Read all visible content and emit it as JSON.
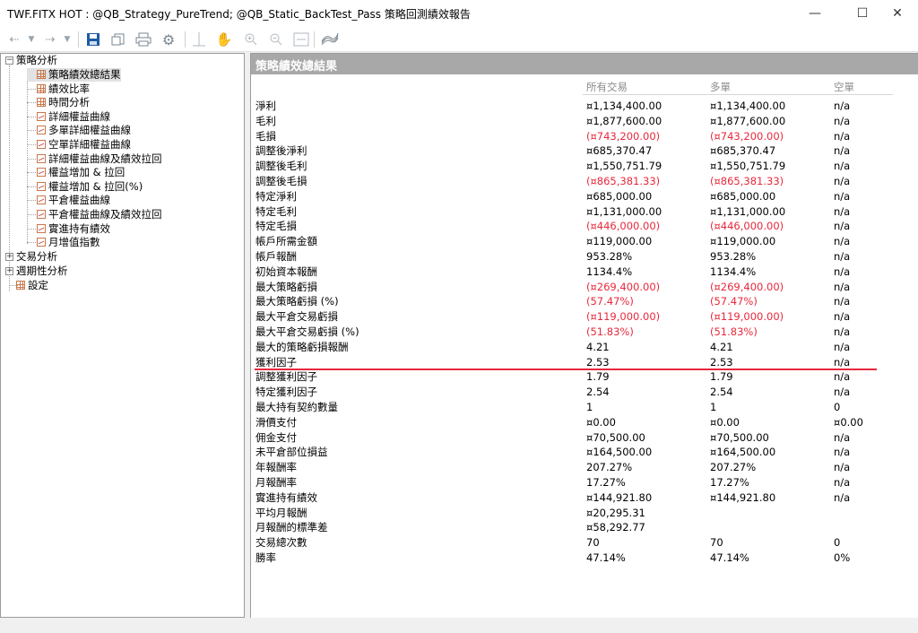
{
  "window": {
    "title": "TWF.FITX HOT : @QB_Strategy_PureTrend; @QB_Static_BackTest_Pass 策略回測績效報告",
    "minimize": "—",
    "maximize": "☐",
    "close": "✕"
  },
  "toolbar": {
    "icons": [
      "back-icon",
      "back-dropdown-icon",
      "forward-icon",
      "forward-dropdown-icon",
      "save-icon",
      "copy-icon",
      "print-icon",
      "settings-icon",
      "crosshair-icon",
      "hand-icon",
      "zoom-in-icon",
      "zoom-out-icon",
      "fit-icon",
      "chart-style-icon"
    ]
  },
  "tree": {
    "root1": "策略分析",
    "items": [
      "策略績效總結果",
      "績效比率",
      "時間分析",
      "詳細權益曲線",
      "多單詳細權益曲線",
      "空單詳細權益曲線",
      "詳細權益曲線及績效拉回",
      "權益增加 & 拉回",
      "權益增加 & 拉回(%)",
      "平倉權益曲線",
      "平倉權益曲線及績效拉回",
      "實進持有績效",
      "月增值指數"
    ],
    "root2": "交易分析",
    "root3": "週期性分析",
    "root4": "設定"
  },
  "report": {
    "title": "策略績效總結果",
    "columns": [
      "所有交易",
      "多單",
      "空單"
    ],
    "rows": [
      {
        "label": "淨利",
        "all": "¤1,134,400.00",
        "long": "¤1,134,400.00",
        "short": "n/a",
        "neg": false
      },
      {
        "label": "毛利",
        "all": "¤1,877,600.00",
        "long": "¤1,877,600.00",
        "short": "n/a",
        "neg": false
      },
      {
        "label": "毛損",
        "all": "(¤743,200.00)",
        "long": "(¤743,200.00)",
        "short": "n/a",
        "neg": true
      },
      {
        "label": "調整後淨利",
        "all": "¤685,370.47",
        "long": "¤685,370.47",
        "short": "n/a",
        "neg": false
      },
      {
        "label": "調整後毛利",
        "all": "¤1,550,751.79",
        "long": "¤1,550,751.79",
        "short": "n/a",
        "neg": false
      },
      {
        "label": "調整後毛損",
        "all": "(¤865,381.33)",
        "long": "(¤865,381.33)",
        "short": "n/a",
        "neg": true
      },
      {
        "label": "特定淨利",
        "all": "¤685,000.00",
        "long": "¤685,000.00",
        "short": "n/a",
        "neg": false
      },
      {
        "label": "特定毛利",
        "all": "¤1,131,000.00",
        "long": "¤1,131,000.00",
        "short": "n/a",
        "neg": false
      },
      {
        "label": "特定毛損",
        "all": "(¤446,000.00)",
        "long": "(¤446,000.00)",
        "short": "n/a",
        "neg": true
      },
      {
        "label": "帳戶所需金額",
        "all": "¤119,000.00",
        "long": "¤119,000.00",
        "short": "n/a",
        "neg": false
      },
      {
        "label": "帳戶報酬",
        "all": "953.28%",
        "long": "953.28%",
        "short": "n/a",
        "neg": false
      },
      {
        "label": "初始資本報酬",
        "all": "1134.4%",
        "long": "1134.4%",
        "short": "n/a",
        "neg": false
      },
      {
        "label": "最大策略虧損",
        "all": "(¤269,400.00)",
        "long": "(¤269,400.00)",
        "short": "n/a",
        "neg": true
      },
      {
        "label": "最大策略虧損 (%)",
        "all": "(57.47%)",
        "long": "(57.47%)",
        "short": "n/a",
        "neg": true
      },
      {
        "label": "最大平倉交易虧損",
        "all": "(¤119,000.00)",
        "long": "(¤119,000.00)",
        "short": "n/a",
        "neg": true
      },
      {
        "label": "最大平倉交易虧損 (%)",
        "all": "(51.83%)",
        "long": "(51.83%)",
        "short": "n/a",
        "neg": true
      },
      {
        "label": "最大的策略虧損報酬",
        "all": "4.21",
        "long": "4.21",
        "short": "n/a",
        "neg": false
      },
      {
        "label": "獲利因子",
        "all": "2.53",
        "long": "2.53",
        "short": "n/a",
        "neg": false
      },
      {
        "label": "調整獲利因子",
        "all": "1.79",
        "long": "1.79",
        "short": "n/a",
        "neg": false
      },
      {
        "label": "特定獲利因子",
        "all": "2.54",
        "long": "2.54",
        "short": "n/a",
        "neg": false
      },
      {
        "label": "最大持有契約數量",
        "all": "1",
        "long": "1",
        "short": "0",
        "neg": false
      },
      {
        "label": "滑價支付",
        "all": "¤0.00",
        "long": "¤0.00",
        "short": "¤0.00",
        "neg": false
      },
      {
        "label": "佣金支付",
        "all": "¤70,500.00",
        "long": "¤70,500.00",
        "short": "n/a",
        "neg": false
      },
      {
        "label": "未平倉部位損益",
        "all": "¤164,500.00",
        "long": "¤164,500.00",
        "short": "n/a",
        "neg": false
      },
      {
        "label": "年報酬率",
        "all": "207.27%",
        "long": "207.27%",
        "short": "n/a",
        "neg": false
      },
      {
        "label": "月報酬率",
        "all": "17.27%",
        "long": "17.27%",
        "short": "n/a",
        "neg": false
      },
      {
        "label": "實進持有績效",
        "all": "¤144,921.80",
        "long": "¤144,921.80",
        "short": "n/a",
        "neg": false
      },
      {
        "label": "平均月報酬",
        "all": "¤20,295.31",
        "long": "",
        "short": "",
        "neg": false
      },
      {
        "label": "月報酬的標準差",
        "all": "¤58,292.77",
        "long": "",
        "short": "",
        "neg": false
      },
      {
        "label": "交易總次數",
        "all": "70",
        "long": "70",
        "short": "0",
        "neg": false
      },
      {
        "label": "勝率",
        "all": "47.14%",
        "long": "47.14%",
        "short": "0%",
        "neg": false
      }
    ]
  },
  "colors": {
    "negative": "#e8283c",
    "header_band": "#a8a8a8",
    "highlight_line": "#e8283c"
  }
}
